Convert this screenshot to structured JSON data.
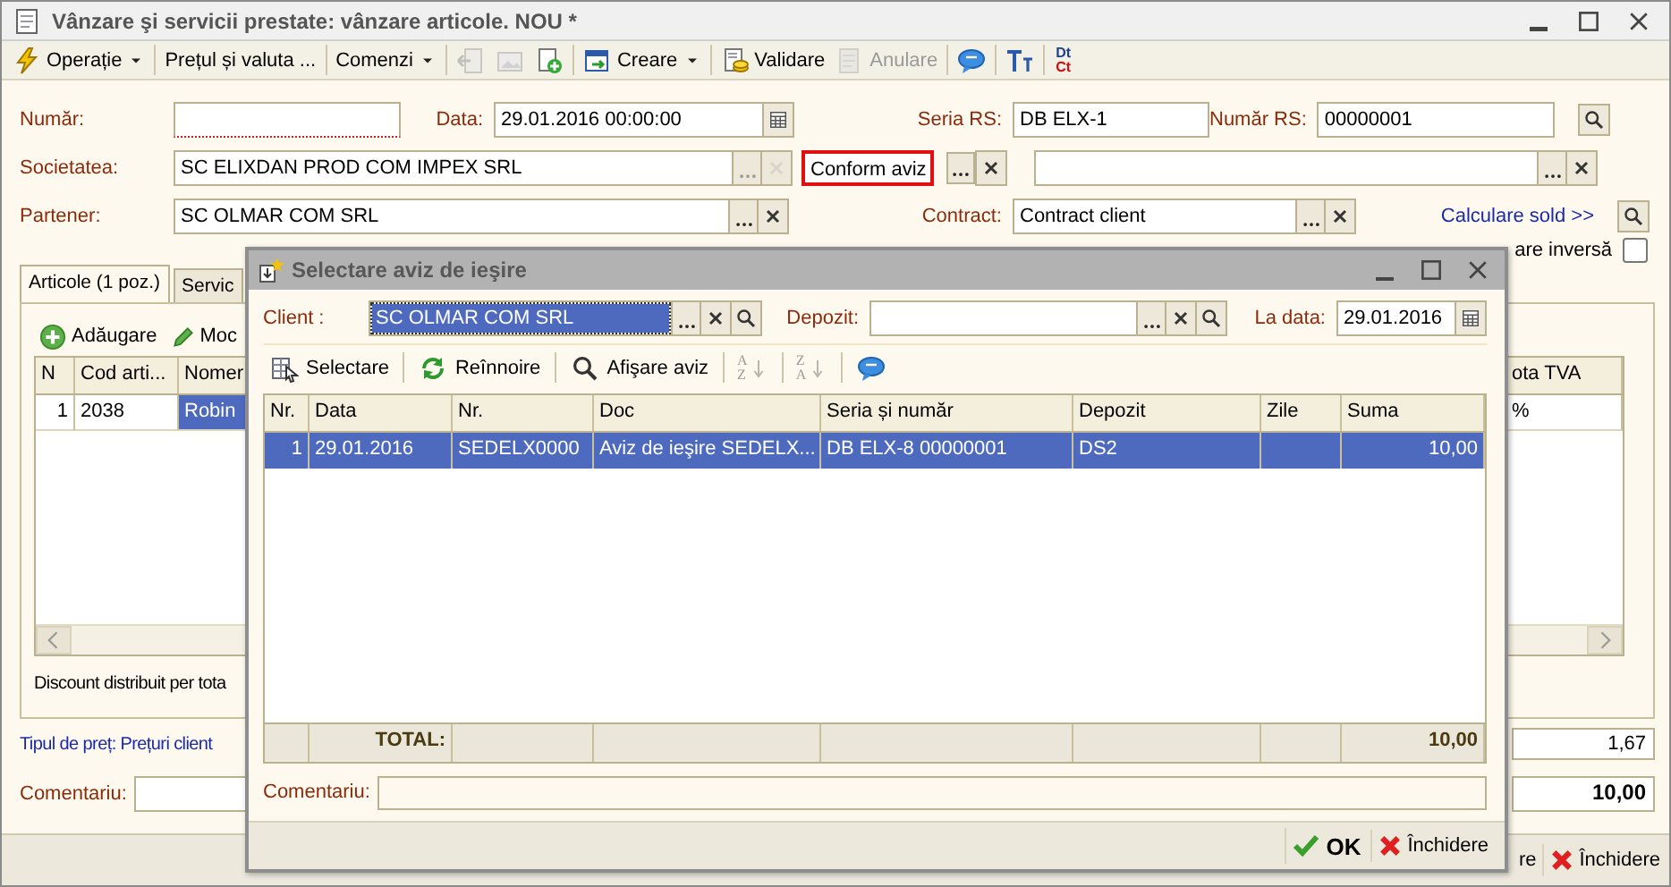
{
  "window": {
    "title": "Vânzare şi servicii prestate: vânzare articole. NOU *"
  },
  "toolbar": [
    [
      {
        "kind": "menu",
        "label": "Operație",
        "disabled": false
      }
    ],
    [
      {
        "kind": "button",
        "label": "Prețul și valuta ...",
        "disabled": false
      }
    ],
    [
      {
        "kind": "menu",
        "label": "Comenzi",
        "disabled": false
      }
    ],
    [
      {
        "kind": "icon",
        "disabled": true
      },
      {
        "kind": "icon",
        "disabled": true
      },
      {
        "kind": "icon",
        "disabled": false
      }
    ],
    [
      {
        "kind": "menu",
        "label": "Creare",
        "disabled": false
      }
    ],
    [
      {
        "kind": "button",
        "label": "Validare",
        "disabled": false
      },
      {
        "kind": "button",
        "label": "Anulare",
        "disabled": true
      }
    ],
    [
      {
        "kind": "icon",
        "disabled": false
      }
    ],
    [
      {
        "kind": "icon",
        "disabled": false
      }
    ],
    [
      {
        "kind": "stacked",
        "lines": [
          "Dt",
          "Ct"
        ],
        "disabled": false
      }
    ]
  ],
  "form": {
    "numar": {
      "label": "Număr:",
      "required": true
    },
    "data": {
      "label": "Data:",
      "value": "29.01.2016 00:00:00"
    },
    "seria_rs": {
      "label": "Seria RS:",
      "value": "DB ELX-1"
    },
    "numar_rs": {
      "label": "Număr RS:",
      "value": "00000001"
    },
    "societatea": {
      "label": "Societatea:",
      "value": "SC ELIXDAN PROD COM IMPEX SRL"
    },
    "tip_document": {
      "value": "Conform aviz",
      "highlighted": true
    },
    "partener": {
      "label": "Partener:",
      "value": "SC OLMAR COM SRL"
    },
    "contract": {
      "label": "Contract:",
      "value": "Contract client"
    },
    "calculare_sold": "Calculare sold >>",
    "taxare_inversa": {
      "label": "are inversă",
      "checked": false
    }
  },
  "tabs": [
    {
      "label": "Articole (1 poz.)",
      "selected": true
    },
    {
      "label": "Servic",
      "selected": false
    }
  ],
  "articles": {
    "toolbar": [
      {
        "label": "Adăugare"
      },
      {
        "label": "Moc"
      }
    ],
    "columns": [
      "N",
      "Cod arti...",
      "Nomer",
      "ota TVA"
    ],
    "rows": [
      {
        "cells": [
          {
            "text": "1",
            "selected": false
          },
          {
            "text": "2038",
            "selected": false
          },
          {
            "text": "Robin",
            "selected": true
          },
          {
            "text": "%",
            "selected": false
          }
        ]
      }
    ],
    "note": "Discount distribuit per tota"
  },
  "price_type": "Tipul de preț: Prețuri client",
  "totals": [
    {
      "value": "1,67",
      "bold": false
    },
    {
      "value": "10,00",
      "bold": true
    }
  ],
  "comment_label": "Comentariu:",
  "footer_buttons": [
    {
      "kind": "plain",
      "label": "re"
    },
    {
      "kind": "close",
      "label": "Închidere"
    }
  ],
  "dialog": {
    "title": "Selectare aviz de ieşire",
    "client": {
      "label": "Client :",
      "value": "SC OLMAR COM SRL",
      "text_selected": true
    },
    "depozit": {
      "label": "Depozit:"
    },
    "la_data": {
      "label": "La data:",
      "value": "29.01.2016"
    },
    "toolbar": [
      {
        "kind": "button",
        "label": "Selectare",
        "disabled": false
      },
      {
        "kind": "button",
        "label": "Reînnoire",
        "disabled": false
      },
      {
        "kind": "button",
        "label": "Afişare aviz",
        "disabled": false
      },
      {
        "kind": "sort",
        "letters": [
          "A",
          "Z"
        ],
        "disabled": true
      },
      {
        "kind": "sort",
        "letters": [
          "Z",
          "A"
        ],
        "disabled": true
      },
      {
        "kind": "icon",
        "disabled": false
      }
    ],
    "columns": [
      "Nr.",
      "Data",
      "Nr.",
      "Doc",
      "Seria și număr",
      "Depozit",
      "Zile",
      "Suma"
    ],
    "rows": [
      {
        "selected": true,
        "nr": "1",
        "data": "29.01.2016",
        "numar": "SEDELX0000",
        "doc": "Aviz de ieşire SEDELX...",
        "seria": "DB ELX-8 00000001",
        "depozit": "DS2",
        "suma": "10,00"
      }
    ],
    "total": {
      "label": "TOTAL:",
      "sum": "10,00"
    },
    "comment_label": "Comentariu:",
    "buttons": [
      {
        "kind": "ok",
        "label": "OK"
      },
      {
        "kind": "close",
        "label": "Închidere"
      }
    ]
  }
}
